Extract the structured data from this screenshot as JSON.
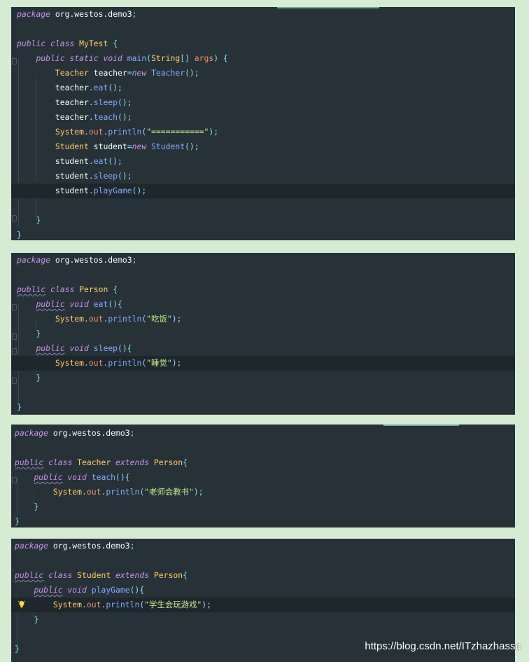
{
  "watermark": "https://blog.csdn.net/ITzhazhassc",
  "files": [
    {
      "name": "MyTest",
      "lines": [
        "package org.westos.demo3;",
        "",
        "public class MyTest {",
        "    public static void main(String[] args) {",
        "        Teacher teacher=new Teacher();",
        "        teacher.eat();",
        "        teacher.sleep();",
        "        teacher.teach();",
        "        System.out.println(\"===========\");",
        "        Student student=new Student();",
        "        student.eat();",
        "        student.sleep();",
        "        student.playGame();",
        "",
        "    }",
        "}"
      ]
    },
    {
      "name": "Person",
      "lines": [
        "package org.westos.demo3;",
        "",
        "public class Person {",
        "    public void eat(){",
        "        System.out.println(\"吃饭\");",
        "    }",
        "    public void sleep(){",
        "        System.out.println(\"睡觉\");",
        "    }",
        "",
        "}"
      ]
    },
    {
      "name": "Teacher",
      "lines": [
        "package org.westos.demo3;",
        "",
        "public class Teacher extends Person{",
        "    public void teach(){",
        "        System.out.println(\"老师会教书\");",
        "    }",
        "}"
      ]
    },
    {
      "name": "Student",
      "lines": [
        "package org.westos.demo3;",
        "",
        "public class Student extends Person{",
        "    public void playGame(){",
        "        System.out.println(\"学生会玩游戏\");",
        "    }",
        "",
        "}"
      ]
    }
  ],
  "colors": {
    "background": "#263238",
    "keyword": "#c792ea",
    "type": "#ffcb6b",
    "function": "#82aaff",
    "parameter": "#f78c6c",
    "string": "#c3e88d",
    "punctuation": "#89ddff",
    "text": "#eeffff"
  }
}
